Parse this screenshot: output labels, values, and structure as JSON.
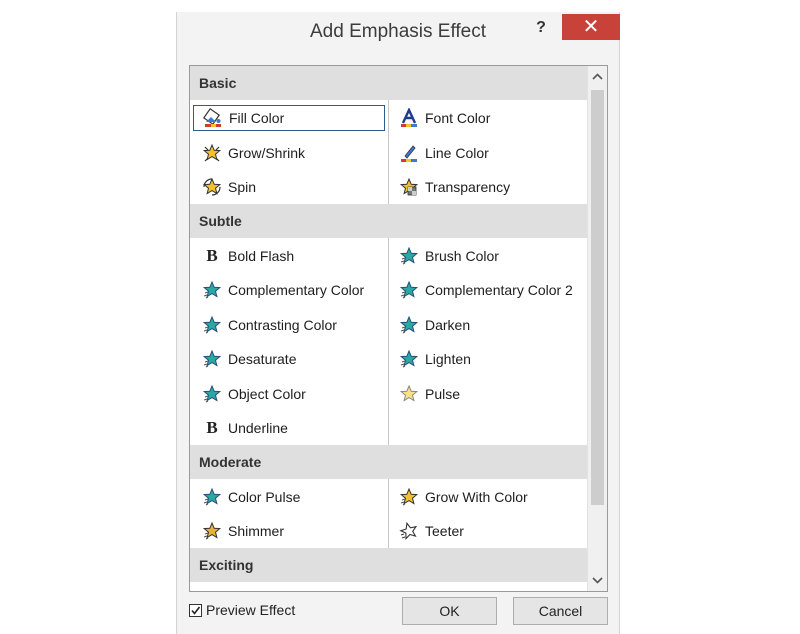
{
  "dialog": {
    "title": "Add Emphasis Effect",
    "help_label": "?",
    "close_label": "✕"
  },
  "colors": {
    "close_button": "#c9423a",
    "header_bg": "#dfdfdf",
    "selection_border": "#2b5f91"
  },
  "sections": [
    {
      "label": "Basic",
      "items": [
        {
          "label": "Fill Color",
          "icon": "fill-color-icon",
          "selected": true
        },
        {
          "label": "Font Color",
          "icon": "font-color-icon"
        },
        {
          "label": "Grow/Shrink",
          "icon": "grow-shrink-icon"
        },
        {
          "label": "Line Color",
          "icon": "line-color-icon"
        },
        {
          "label": "Spin",
          "icon": "spin-icon"
        },
        {
          "label": "Transparency",
          "icon": "transparency-icon"
        }
      ]
    },
    {
      "label": "Subtle",
      "items": [
        {
          "label": "Bold Flash",
          "icon": "bold-icon"
        },
        {
          "label": "Brush Color",
          "icon": "star-effect-icon"
        },
        {
          "label": "Complementary Color",
          "icon": "star-effect-icon"
        },
        {
          "label": "Complementary Color 2",
          "icon": "star-effect-icon"
        },
        {
          "label": "Contrasting Color",
          "icon": "star-effect-icon"
        },
        {
          "label": "Darken",
          "icon": "star-effect-icon"
        },
        {
          "label": "Desaturate",
          "icon": "star-effect-icon"
        },
        {
          "label": "Lighten",
          "icon": "star-effect-icon"
        },
        {
          "label": "Object Color",
          "icon": "star-effect-icon"
        },
        {
          "label": "Pulse",
          "icon": "pulse-icon"
        },
        {
          "label": "Underline",
          "icon": "bold-icon"
        }
      ]
    },
    {
      "label": "Moderate",
      "items": [
        {
          "label": "Color Pulse",
          "icon": "star-effect-icon"
        },
        {
          "label": "Grow With Color",
          "icon": "grow-with-color-icon"
        },
        {
          "label": "Shimmer",
          "icon": "shimmer-icon"
        },
        {
          "label": "Teeter",
          "icon": "teeter-icon"
        }
      ]
    },
    {
      "label": "Exciting",
      "items": []
    }
  ],
  "footer": {
    "preview_label": "Preview Effect",
    "preview_checked": true,
    "ok_label": "OK",
    "cancel_label": "Cancel"
  }
}
